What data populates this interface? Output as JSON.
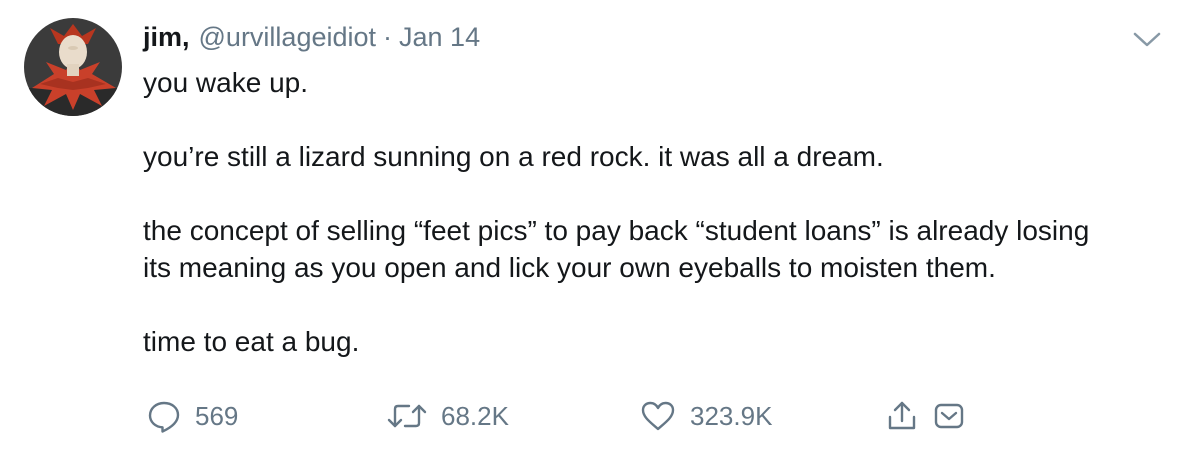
{
  "tweet": {
    "display_name": "jim,",
    "handle": "@urvillageidiot",
    "separator": "·",
    "date": "Jan 14",
    "paragraphs": [
      "you wake up.",
      "you’re still a lizard sunning on a red rock. it was all a dream.",
      "the concept of selling “feet pics” to pay back “student loans” is already losing\nits meaning as you open and lick your own eyeballs to moisten them.",
      "time to eat a bug."
    ]
  },
  "actions": {
    "reply_count": "569",
    "retweet_count": "68.2K",
    "like_count": "323.9K"
  },
  "icons": {
    "avatar": "avatar-mannequin-jester",
    "caret": "chevron-down-icon",
    "reply": "reply-icon",
    "retweet": "retweet-icon",
    "like": "heart-icon",
    "share": "share-icon",
    "dm": "direct-message-icon"
  },
  "colors": {
    "text": "#14171a",
    "secondary": "#657786",
    "caret": "#8899a6",
    "avatar_bg": "#3a3a3a",
    "avatar_red": "#c9402a"
  }
}
